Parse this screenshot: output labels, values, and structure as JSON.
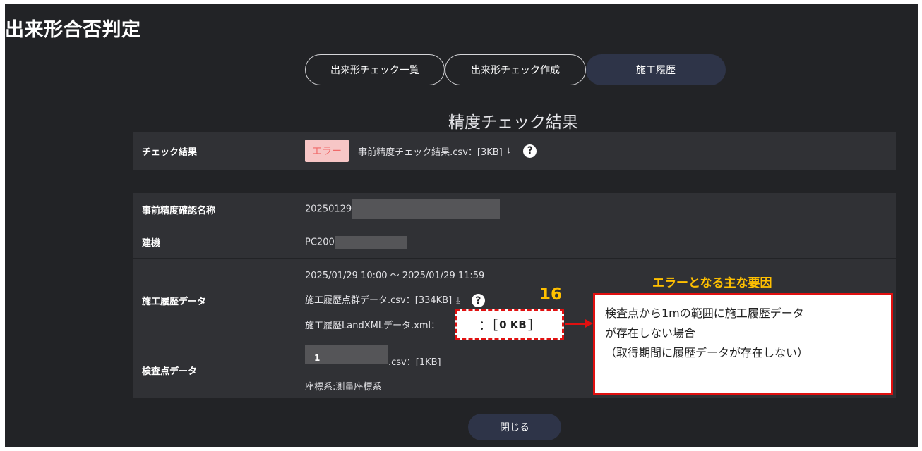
{
  "page": {
    "title": "出来形合否判定"
  },
  "tabs": [
    {
      "label": "出来形チェック一覧"
    },
    {
      "label": "出来形チェック作成"
    },
    {
      "label": "施工履歴"
    }
  ],
  "section_title": "精度チェック結果",
  "check_result": {
    "label": "チェック結果",
    "status": "エラー",
    "file": "事前精度チェック結果.csv：[3KB]"
  },
  "details": {
    "name": {
      "label": "事前精度確認名称",
      "value": "20250129"
    },
    "machine": {
      "label": "建機",
      "value": "PC200"
    },
    "history": {
      "label": "施工履歴データ",
      "period": "2025/01/29 10:00 ～ 2025/01/29 11:59",
      "pointcloud": "施工履歴点群データ.csv：[334KB]",
      "landxml": "施工履歴LandXMLデータ.xml："
    },
    "checkpoint": {
      "label": "検査点データ",
      "file_prefix": "1",
      "file_suffix": ".csv：[1KB]",
      "coord": "座標系:測量座標系"
    }
  },
  "close_label": "閉じる",
  "annotation": {
    "title": "エラーとなる主な要因",
    "number": "16",
    "highlight_prefix": "：［",
    "highlight_size": "0 KB",
    "highlight_suffix": "］",
    "lines": [
      "検査点から1mの範囲に施工履歴データ",
      "が存在しない場合",
      "（取得期間に履歴データが存在しない）"
    ]
  },
  "colors": {
    "accent": "#2e3448",
    "error_badge": "#f7c6c6",
    "annotation": "#e01010",
    "annotation_title": "#ffc000"
  },
  "icons": {
    "download": "download-icon",
    "help": "help-icon"
  }
}
